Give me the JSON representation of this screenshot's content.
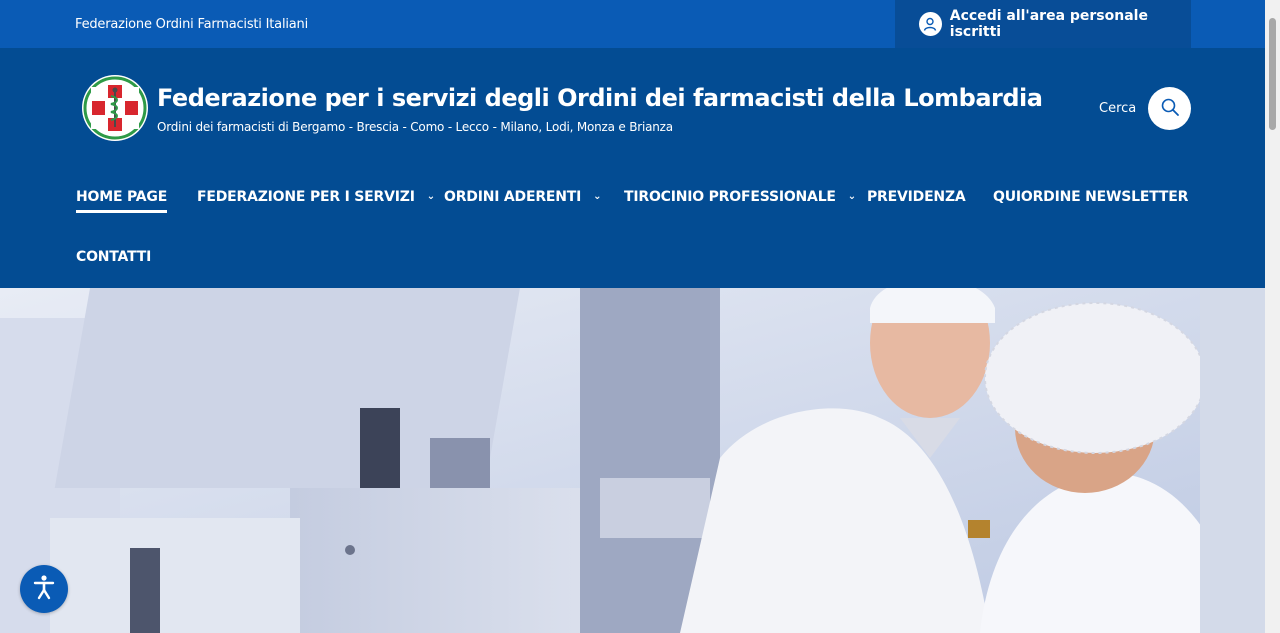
{
  "topbar": {
    "fofi_link": "Federazione Ordini Farmacisti Italiani",
    "login_label": "Accedi all'area personale iscritti",
    "login_icon": "user-icon"
  },
  "header": {
    "title": "Federazione per i servizi degli Ordini dei farmacisti della Lombardia",
    "subtitle": "Ordini dei farmacisti di Bergamo - Brescia - Como - Lecco - Milano, Lodi, Monza e Brianza",
    "search_label": "Cerca",
    "search_icon": "search-icon"
  },
  "nav": {
    "home": "HOME PAGE",
    "federazione": "FEDERAZIONE PER I SERVIZI",
    "ordini": "ORDINI ADERENTI",
    "tirocinio": "TIROCINIO PROFESSIONALE",
    "previdenza": "PREVIDENZA",
    "newsletter": "QUIORDINE NEWSLETTER",
    "contatti": "CONTATTI",
    "chevron": "⌄"
  },
  "colors": {
    "topbar": "#0a5bb5",
    "header": "#034c93",
    "accent": "#ffffff"
  },
  "accessibility": {
    "icon": "accessibility-icon"
  }
}
